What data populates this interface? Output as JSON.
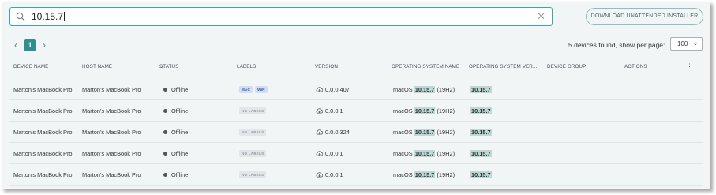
{
  "search": {
    "value": "10.15.7",
    "clear_icon": "close-icon"
  },
  "download_button": "DOWNLOAD UNATTENDED INSTALLER",
  "pagination": {
    "prev": "‹",
    "current_page": "1",
    "next": "›"
  },
  "results": {
    "found_text": "5 devices found, show per page:",
    "per_page": "100"
  },
  "columns": [
    "DEVICE NAME",
    "HOST NAME",
    "STATUS",
    "LABELS",
    "VERSION",
    "OPERATING SYSTEM NAME",
    "OPERATING SYSTEM VER...",
    "DEVICE GROUP",
    "ACTIONS"
  ],
  "rows": [
    {
      "device": "Marton's MacBook Pro",
      "host": "Marton's MacBook Pro",
      "status": "Offline",
      "labels": [
        "MAC",
        "WIN"
      ],
      "version": "0.0.0.407",
      "os_prefix": "macOS",
      "os_match": "10.15.7",
      "os_suffix": "(19H2)",
      "os_version": "10.15.7"
    },
    {
      "device": "Marton's MacBook Pro",
      "host": "Marton's MacBook Pro",
      "status": "Offline",
      "labels": [
        "NO LABELS"
      ],
      "version": "0.0.0.1",
      "os_prefix": "macOS",
      "os_match": "10.15.7",
      "os_suffix": "(19H2)",
      "os_version": "10.15.7"
    },
    {
      "device": "Marton's MacBook Pro",
      "host": "Marton's MacBook Pro",
      "status": "Offline",
      "labels": [
        "NO LABELS"
      ],
      "version": "0.0.0.324",
      "os_prefix": "macOS",
      "os_match": "10.15.7",
      "os_suffix": "(19H2)",
      "os_version": "10.15.7"
    },
    {
      "device": "Marton's MacBook Pro",
      "host": "Marton's MacBook Pro",
      "status": "Offline",
      "labels": [
        "NO LABELS"
      ],
      "version": "0.0.0.1",
      "os_prefix": "macOS",
      "os_match": "10.15.7",
      "os_suffix": "(19H2)",
      "os_version": "10.15.7"
    },
    {
      "device": "Marton's MacBook Pro",
      "host": "Marton's MacBook Pro",
      "status": "Offline",
      "labels": [
        "NO LABELS"
      ],
      "version": "0.0.0.1",
      "os_prefix": "macOS",
      "os_match": "10.15.7",
      "os_suffix": "(19H2)",
      "os_version": "10.15.7"
    }
  ],
  "colors": {
    "accent": "#2f8f8c",
    "search_border": "#3fa7a3",
    "highlight": "#bcd9d6",
    "label_blue": "#d2def5",
    "label_gray": "#e3e6e8"
  }
}
